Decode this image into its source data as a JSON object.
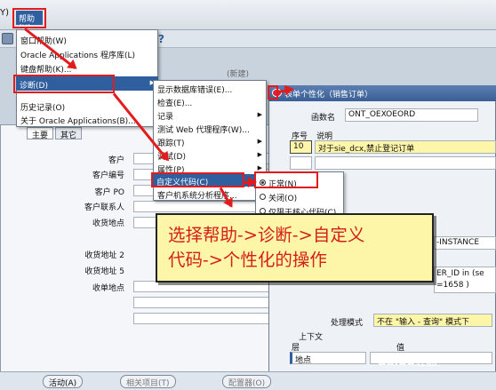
{
  "menubar": {
    "prefix": "Y)",
    "help_label": "帮助(H)"
  },
  "dropdown": {
    "items": [
      "窗口帮助(W)",
      "Oracle Applications 程序库(L)",
      "键盘帮助(K)...",
      "诊断(D)",
      "历史记录(O)",
      "关于 Oracle Applications(B)..."
    ]
  },
  "submenu": {
    "items": [
      "显示数据库错误(E)...",
      "检查(E)...",
      "记录",
      "测试 Web 代理程序(W)...",
      "跟踪(T)",
      "调试(D)",
      "属性(P)",
      "自定义代码(C)",
      "客户机系统分析程序..."
    ]
  },
  "sub2": {
    "items": [
      "正常(N)",
      "关闭(O)",
      "仅限于核心代码(C)"
    ]
  },
  "left_form": {
    "tabs": [
      "主要",
      "其它"
    ],
    "labels": [
      "客户",
      "客户编号",
      "客户 PO",
      "客户联系人",
      "收货地点",
      "收货地址 2",
      "收货地址 5",
      "收单地点"
    ],
    "bg_tag": "(新建)"
  },
  "right_window": {
    "title": "表单个性化（销售订单）",
    "function_label": "函数名",
    "function_value": "ONT_OEXOEORD",
    "seq_label": "序号",
    "desc_label": "说明",
    "seq_value": "10",
    "desc_value": "对于sie_dcx,禁止登记订单",
    "cond_text1": "-INSTANCE",
    "cond_text2": "ER_ID  in (se",
    "cond_text3": "=1658 )",
    "mode_label": "处理模式",
    "mode_value": "不在 \"输入 - 查询\" 模式下",
    "context_label": "上下文",
    "level_label": "层",
    "value_label": "值",
    "row_value": "地点"
  },
  "annotation": {
    "line1": "选择帮助->诊断->自定义",
    "line2": "代码->个性化的操作"
  },
  "bottom_bar": {
    "buttons": [
      "活动(A)",
      "相关项目(T)",
      "配置器(O)"
    ]
  },
  "watermark": "Baidu经验",
  "colors": {
    "highlight": "#2f5f9e",
    "annotation_text": "#d42018",
    "annotation_bg": "#fdf6a8",
    "red_marker": "#e21c1c"
  }
}
